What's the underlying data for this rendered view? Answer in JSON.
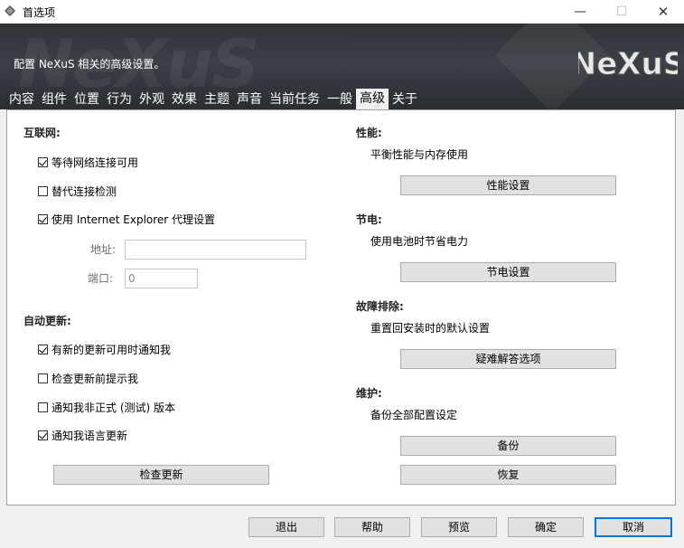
{
  "window": {
    "title": "首选项",
    "minimize": "—",
    "maximize": "☐",
    "close": "✕"
  },
  "banner": {
    "tagline": "配置 NeXuS 相关的高级设置。",
    "logo_text": "NeXuS",
    "watermark": "NeXuS"
  },
  "tabs": [
    {
      "label": "内容"
    },
    {
      "label": "组件"
    },
    {
      "label": "位置"
    },
    {
      "label": "行为"
    },
    {
      "label": "外观"
    },
    {
      "label": "效果"
    },
    {
      "label": "主题"
    },
    {
      "label": "声音"
    },
    {
      "label": "当前任务"
    },
    {
      "label": "一般"
    },
    {
      "label": "高级"
    },
    {
      "label": "关于"
    }
  ],
  "active_tab": "高级",
  "internet": {
    "title": "互联网:",
    "wait_network": {
      "label": "等待网络连接可用",
      "checked": true
    },
    "alt_detect": {
      "label": "替代连接检测",
      "checked": false
    },
    "use_ie_proxy": {
      "label": "使用 Internet Explorer 代理设置",
      "checked": true
    },
    "address_label": "地址:",
    "address_value": "",
    "port_label": "端口:",
    "port_value": "0"
  },
  "updates": {
    "title": "自动更新:",
    "notify_new": {
      "label": "有新的更新可用时通知我",
      "checked": true
    },
    "prompt_before": {
      "label": "检查更新前提示我",
      "checked": false
    },
    "notify_beta": {
      "label": "通知我非正式 (测试) 版本",
      "checked": false
    },
    "notify_lang": {
      "label": "通知我语言更新",
      "checked": true
    },
    "check_button": "检查更新"
  },
  "performance": {
    "title": "性能:",
    "value": "平衡性能与内存使用",
    "button": "性能设置"
  },
  "power": {
    "title": "节电:",
    "value": "使用电池时节省电力",
    "button": "节电设置"
  },
  "troubleshoot": {
    "title": "故障排除:",
    "value": "重置回安装时的默认设置",
    "button": "疑难解答选项"
  },
  "maintenance": {
    "title": "维护:",
    "value": "备份全部配置设定",
    "backup_button": "备份",
    "restore_button": "恢复"
  },
  "footer": {
    "exit": "退出",
    "help": "帮助",
    "preview": "预览",
    "ok": "确定",
    "cancel": "取消"
  },
  "colors": {
    "banner_bg": "#2e3338",
    "default_button_border": "#0078d7"
  }
}
